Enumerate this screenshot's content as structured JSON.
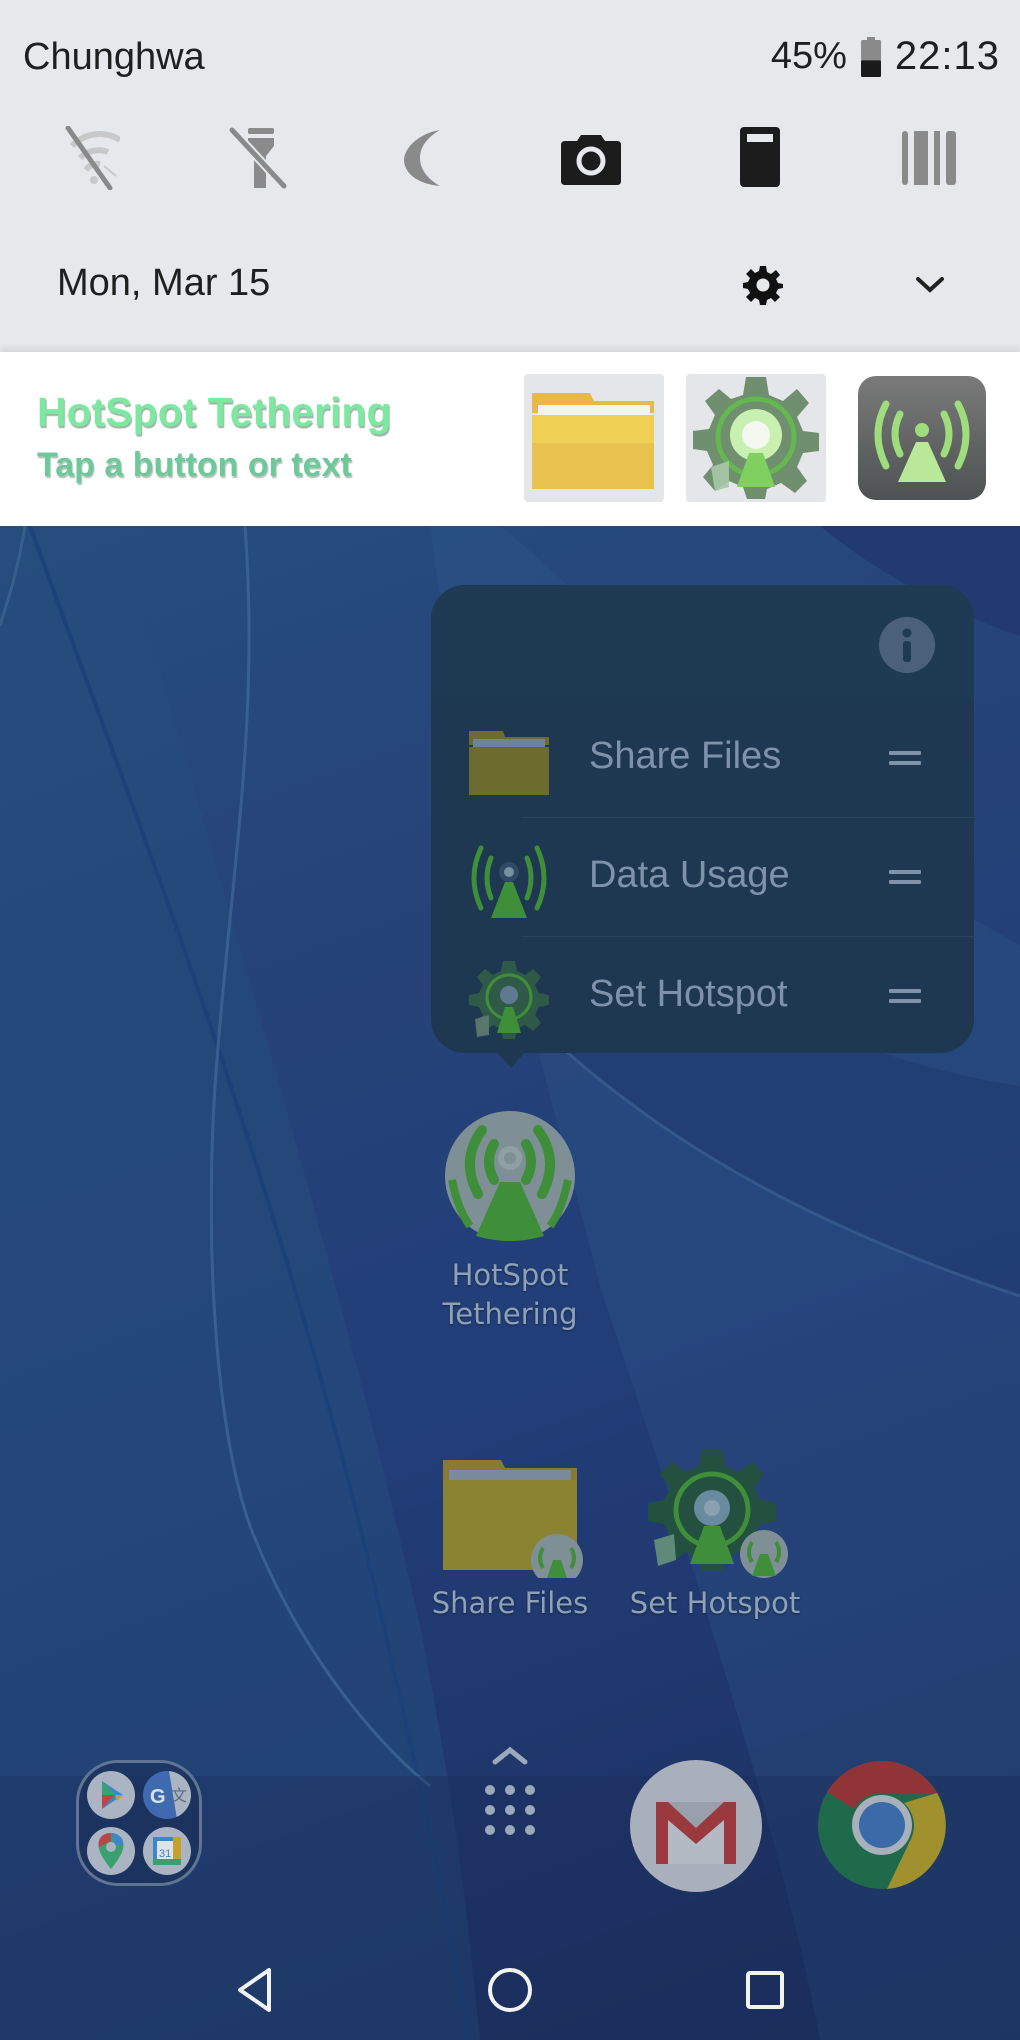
{
  "status_bar": {
    "carrier": "Chunghwa",
    "battery_percent": "45%",
    "battery_level": 0.45,
    "time": "22:13"
  },
  "quick_settings": [
    {
      "name": "wifi-off",
      "state": "off"
    },
    {
      "name": "flashlight-off",
      "state": "off"
    },
    {
      "name": "do-not-disturb",
      "state": "off"
    },
    {
      "name": "camera",
      "state": "on"
    },
    {
      "name": "clipboard",
      "state": "on"
    },
    {
      "name": "barcode",
      "state": "off"
    }
  ],
  "shade": {
    "date": "Mon, Mar 15"
  },
  "notification": {
    "title": "HotSpot Tethering",
    "subtitle": "Tap a button or text",
    "buttons": [
      {
        "icon": "folder-icon"
      },
      {
        "icon": "hotspot-settings-icon"
      },
      {
        "icon": "hotspot-icon"
      }
    ],
    "title_color": "#7ce8a0",
    "subtitle_color": "#6ec99a"
  },
  "shortcut_popup": {
    "items": [
      {
        "label": "Share Files",
        "icon": "folder-icon"
      },
      {
        "label": "Data Usage",
        "icon": "hotspot-icon"
      },
      {
        "label": "Set Hotspot",
        "icon": "hotspot-settings-icon"
      }
    ]
  },
  "home": {
    "apps": [
      {
        "label_line1": "HotSpot",
        "label_line2": "Tethering"
      },
      {
        "label": "Share Files"
      },
      {
        "label": "Set Hotspot"
      }
    ],
    "dock": {
      "folder_apps": [
        "Play Store",
        "Google Translate",
        "Google Maps",
        "Google Calendar"
      ],
      "calendar_day": "31",
      "apps": [
        "Gmail",
        "Chrome"
      ]
    }
  },
  "nav_bar": {
    "buttons": [
      "back",
      "home",
      "recents"
    ]
  }
}
